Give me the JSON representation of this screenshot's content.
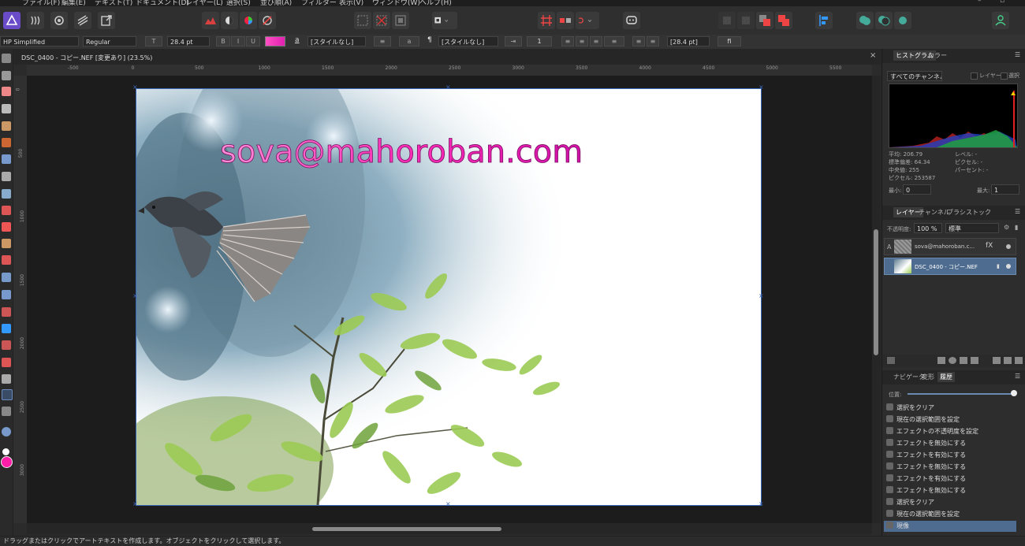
{
  "menu": [
    "ファイル(F)",
    "編集(E)",
    "テキスト(T)",
    "ドキュメント(D)",
    "レイヤー(L)",
    "選択(S)",
    "並び順(A)",
    "フィルター",
    "表示(V)",
    "ウィンドウ(W)",
    "ヘルプ(H)"
  ],
  "context_bar": {
    "font_family": "HP Simplified",
    "font_style": "Regular",
    "font_size": "28.4 pt",
    "char_style": "[スタイルなし]",
    "para_style": "[スタイルなし]",
    "para_value": "1",
    "leading": "[28.4 pt]",
    "a_glyph": "a",
    "fi_glyph": "fi"
  },
  "document": {
    "tab_title": "DSC_0400 - コピー.NEF [変更あり] (23.5%)",
    "close_glyph": "×",
    "watermark_text": "sova@mahoroban.com"
  },
  "ruler": {
    "h_ticks": [
      "-500",
      "0",
      "500",
      "1000",
      "1500",
      "2000",
      "2500",
      "3000",
      "3500",
      "4000",
      "4500",
      "5000",
      "5500"
    ],
    "v_ticks": [
      "0",
      "500",
      "1000",
      "1500",
      "2000",
      "2500",
      "3000"
    ]
  },
  "histogram": {
    "tabs": [
      "ヒストグラム",
      "カラー"
    ],
    "channel_select": "すべてのチャンネル",
    "check_layer": "レイヤー",
    "check_selection": "選択",
    "stats_left": [
      "平均: 206.79",
      "標準偏差: 64.34",
      "中央値: 255",
      "ピクセル: 253587"
    ],
    "stats_right": [
      "レベル: -",
      "ピクセル: -",
      "パーセント: -"
    ],
    "min_label": "最小:",
    "min_value": "0",
    "max_label": "最大:",
    "max_value": "1"
  },
  "layers": {
    "tabs": [
      "レイヤー",
      "チャンネル",
      "ブラシ",
      "ストック"
    ],
    "opacity_label": "不透明度:",
    "opacity_value": "100 %",
    "blend_mode": "標準",
    "items": [
      {
        "name": "sova@mahoroban.c...",
        "prefix": "A",
        "badge": "fX"
      },
      {
        "name": "DSC_0400 - コピー.NEF",
        "prefix": "",
        "badge": ""
      }
    ]
  },
  "history": {
    "tabs": [
      "ナビゲータ",
      "変形",
      "履歴"
    ],
    "position_label": "位置:",
    "position_fraction": 0.98,
    "items": [
      "選択をクリア",
      "現在の選択範囲を設定",
      "エフェクトの不透明度を設定",
      "エフェクトを無効にする",
      "エフェクトを有効にする",
      "エフェクトを無効にする",
      "エフェクトを有効にする",
      "エフェクトを無効にする",
      "選択をクリア",
      "現在の選択範囲を設定",
      "現像"
    ]
  },
  "status": {
    "text": "ドラッグまたはクリックでアートテキストを作成します。オブジェクトをクリックして選択します。"
  },
  "colors": {
    "accent": "#4e6c90",
    "text_gradient_start": "#ff4fc3",
    "text_gradient_end": "#c000a0",
    "selection_blue": "#3a66b8"
  }
}
